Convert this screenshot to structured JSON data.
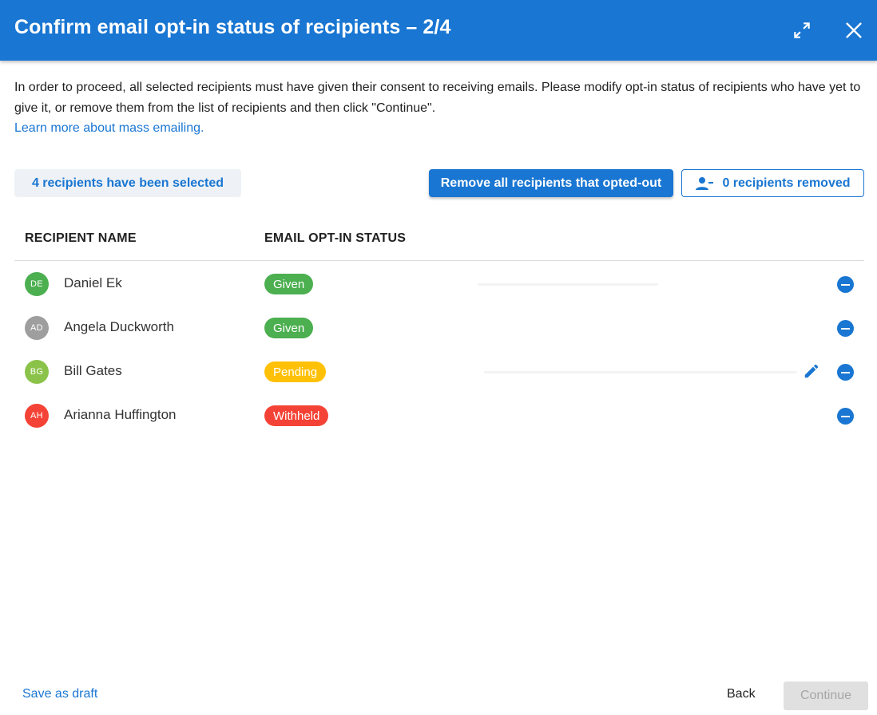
{
  "dialog": {
    "title": "Confirm email opt-in status of recipients – 2/4",
    "intro": "In order to proceed, all selected recipients must have given their consent to receiving emails. Please modify opt-in status of recipients who have yet to give it, or remove them from the list of recipients and then click \"Continue\".",
    "learn_more": "Learn more about mass emailing."
  },
  "toolbar": {
    "selected_label": "4 recipients have been selected",
    "remove_all_label": "Remove all recipients that opted-out",
    "removed_label": "0 recipients removed"
  },
  "table": {
    "columns": [
      "RECIPIENT NAME",
      "EMAIL OPT-IN STATUS"
    ],
    "rows": [
      {
        "initials": "DE",
        "name": "Daniel Ek",
        "status": "Given",
        "avatar_color": "#4caf50",
        "status_color": "#4caf50"
      },
      {
        "initials": "AD",
        "name": "Angela Duckworth",
        "status": "Given",
        "avatar_color": "#9e9e9e",
        "status_color": "#4caf50"
      },
      {
        "initials": "BG",
        "name": "Bill Gates",
        "status": "Pending",
        "avatar_color": "#8bc34a",
        "status_color": "#ffc107"
      },
      {
        "initials": "AH",
        "name": "Arianna Huffington",
        "status": "Withheld",
        "avatar_color": "#f44336",
        "status_color": "#f44336"
      }
    ]
  },
  "footer": {
    "save_draft": "Save as draft",
    "back": "Back",
    "continue": "Continue"
  },
  "colors": {
    "primary": "#1976d2",
    "given": "#4caf50",
    "pending": "#ffc107",
    "withheld": "#f44336"
  }
}
